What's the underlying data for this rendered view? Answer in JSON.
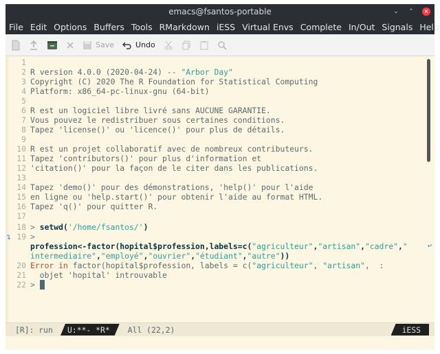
{
  "window": {
    "title": "emacs@fsantos-portable",
    "controls": {
      "minimize": "⌄",
      "maximize": "⌃",
      "close": "×"
    }
  },
  "menubar": {
    "items": [
      "File",
      "Edit",
      "Options",
      "Buffers",
      "Tools",
      "RMarkdown",
      "iESS",
      "Virtual Envs",
      "Complete",
      "In/Out",
      "Signals",
      "Help"
    ]
  },
  "toolbar": {
    "save_label": "Save",
    "undo_label": "Undo",
    "icons": [
      "new-file-icon",
      "open-file-icon",
      "dired-icon",
      "close-icon",
      "save-icon",
      "undo-icon",
      "cut-icon",
      "copy-icon",
      "paste-icon",
      "search-icon"
    ]
  },
  "editor": {
    "lines": [
      {
        "n": "1",
        "text": ""
      },
      {
        "n": "2",
        "text": "R version 4.0.0 (2020-04-24) -- ",
        "str": "\"Arbor Day\""
      },
      {
        "n": "3",
        "text": "Copyright (C) 2020 The R Foundation for Statistical Computing"
      },
      {
        "n": "4",
        "text": "Platform: x86_64-pc-linux-gnu (64-bit)"
      },
      {
        "n": "5",
        "text": ""
      },
      {
        "n": "6",
        "text": "R est un logiciel libre livré sans AUCUNE GARANTIE."
      },
      {
        "n": "7",
        "text": "Vous pouvez le redistribuer sous certaines conditions."
      },
      {
        "n": "8",
        "text": "Tapez 'license()' ou 'licence()' pour plus de détails."
      },
      {
        "n": "9",
        "text": ""
      },
      {
        "n": "10",
        "text": "R est un projet collaboratif avec de nombreux contributeurs."
      },
      {
        "n": "11",
        "text": "Tapez 'contributors()' pour plus d'information et"
      },
      {
        "n": "12",
        "text": "'citation()' pour la façon de le citer dans les publications."
      },
      {
        "n": "13",
        "text": ""
      },
      {
        "n": "14",
        "text": "Tapez 'demo()' pour des démonstrations, 'help()' pour l'aide"
      },
      {
        "n": "15",
        "text": "en ligne ou 'help.start()' pour obtenir l'aide au format HTML."
      },
      {
        "n": "16",
        "text": "Tapez 'q()' pour quitter R."
      },
      {
        "n": "17",
        "text": ""
      }
    ],
    "line18": {
      "n": "18",
      "prompt": "> ",
      "cmd": "setwd(",
      "str": "'/home/fsantos/'",
      "close": ")"
    },
    "line19": {
      "n": "19",
      "prompt": ">"
    },
    "line19_cont1": {
      "a": "profession<-factor(hopital$profession,labels=c(",
      "s1": "\"agriculteur\"",
      "c1": ",",
      "s2": "\"artisan\"",
      "c2": ",",
      "s3": "\"cadre\"",
      "c3": ",",
      "s4": "\""
    },
    "line19_cont2": {
      "s1": "intermediaire\"",
      "c1": ",",
      "s2": "\"employé\"",
      "c2": ",",
      "s3": "\"ouvrier\"",
      "c3": ",",
      "s4": "\"étudiant\"",
      "c4": ",",
      "s5": "\"autre\"",
      "end": "))"
    },
    "line20": {
      "n": "20",
      "err": "Error in",
      "a": " factor(hopital$profession, labels = c(",
      "s1": "\"agriculteur\"",
      "c1": ", ",
      "s2": "\"artisan\"",
      "tail": ",  :"
    },
    "line21": {
      "n": "21",
      "text": "  objet 'hopital' introuvable"
    },
    "line22": {
      "n": "22",
      "prompt": "> "
    },
    "fringe_arrow": "↴",
    "wrap_marker": "↩"
  },
  "modeline": {
    "process": "[R]: run",
    "status": "U:**-  *R*",
    "position": "All (22,2)",
    "mode": "iESS"
  },
  "colors": {
    "background": "#fdf6e3",
    "string": "#2aa198",
    "error": "#cb4b16",
    "line_number": "#a8aea3",
    "menubar": "#2b2e33"
  }
}
